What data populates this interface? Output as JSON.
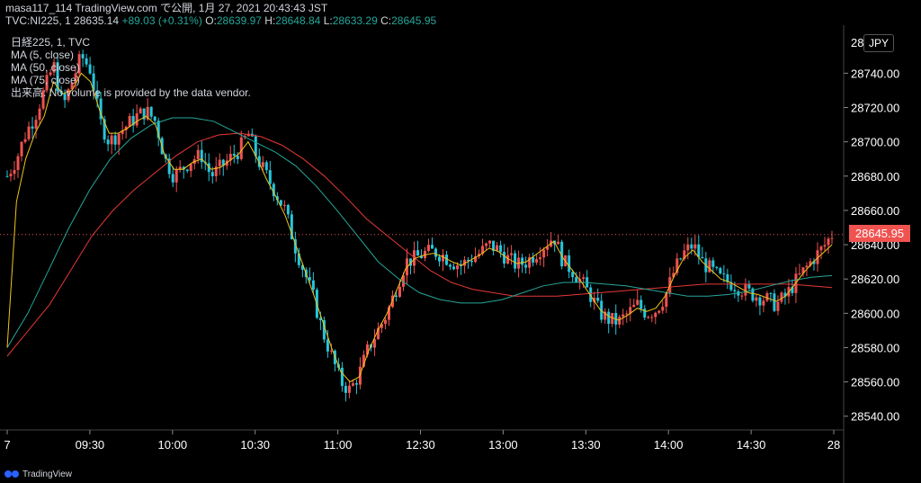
{
  "header": {
    "line1": "masa117_114 TradingView.com で公開, 1月 27, 2021 20:43:43 JST",
    "symbol": "TVC:NI225, 1",
    "price": "28635.14",
    "change": "+89.03 (+0.31%)",
    "o_label": "O:",
    "o_value": "28639.97",
    "h_label": "H:",
    "h_value": "28648.84",
    "l_label": "L:",
    "l_value": "28633.29",
    "c_label": "C:",
    "c_value": "28645.95"
  },
  "legend": {
    "title": "日経225, 1, TVC",
    "ma5": "MA (5, close)",
    "ma50": "MA (50, close)",
    "ma75": "MA (75, close)",
    "volume_note": "出来高: No volume is provided by the data vendor."
  },
  "currency": "JPY",
  "last_price_label": "28645.95",
  "branding": "TradingView",
  "colors": {
    "up": "#ef5350",
    "down": "#26c6da",
    "ma5": "#f0c419",
    "ma50": "#26a69a",
    "ma75": "#e53935",
    "axis_text": "#ffffff",
    "grid": "#1a1a1a"
  },
  "chart_data": {
    "type": "candlestick",
    "x_ticks": [
      "7",
      "09:30",
      "10:00",
      "10:30",
      "11:00",
      "12:30",
      "13:00",
      "13:30",
      "14:00",
      "14:30",
      "28"
    ],
    "y_ticks": [
      28540,
      28560,
      28580,
      28600,
      28620,
      28640,
      28660,
      28680,
      28700,
      28720,
      28740
    ],
    "ylim": [
      28532,
      28768
    ],
    "last_price": 28645.95,
    "close_path": [
      28680,
      28690,
      28705,
      28715,
      28730,
      28745,
      28720,
      28735,
      28750,
      28742,
      28712,
      28700,
      28705,
      28710,
      28715,
      28718,
      28712,
      28690,
      28680,
      28685,
      28690,
      28692,
      28680,
      28685,
      28690,
      28695,
      28705,
      28690,
      28680,
      28670,
      28660,
      28640,
      28625,
      28610,
      28590,
      28575,
      28560,
      28555,
      28565,
      28580,
      28590,
      28600,
      28615,
      28630,
      28632,
      28635,
      28636,
      28634,
      28630,
      28628,
      28632,
      28635,
      28640,
      28637,
      28632,
      28628,
      28630,
      28635,
      28640,
      28645,
      28630,
      28625,
      28618,
      28610,
      28600,
      28596,
      28595,
      28600,
      28605,
      28600,
      28602,
      28610,
      28625,
      28635,
      28640,
      28630,
      28625,
      28620,
      28618,
      28615,
      28612,
      28610,
      28608,
      28605,
      28610,
      28618,
      28625,
      28632,
      28638,
      28645.95
    ],
    "ma5_path": [
      28580,
      28665,
      28690,
      28705,
      28715,
      28735,
      28728,
      28730,
      28740,
      28735,
      28718,
      28705,
      28705,
      28708,
      28712,
      28715,
      28710,
      28692,
      28684,
      28684,
      28688,
      28690,
      28684,
      28685,
      28689,
      28693,
      28700,
      28690,
      28678,
      28668,
      28657,
      28642,
      28627,
      28612,
      28596,
      28580,
      28566,
      28560,
      28563,
      28578,
      28590,
      28600,
      28613,
      28626,
      28632,
      28634,
      28635,
      28633,
      28630,
      28628,
      28631,
      28634,
      28638,
      28636,
      28632,
      28629,
      28630,
      28634,
      28638,
      28642,
      28632,
      28625,
      28618,
      28610,
      28602,
      28598,
      28596,
      28599,
      28603,
      28601,
      28603,
      28610,
      28622,
      28632,
      28637,
      28630,
      28625,
      28620,
      28618,
      28615,
      28612,
      28611,
      28609,
      28607,
      28610,
      28617,
      28624,
      28630,
      28635,
      28640
    ],
    "ma50_path": [
      28580,
      28600,
      28625,
      28650,
      28672,
      28690,
      28702,
      28710,
      28714,
      28714,
      28712,
      28706,
      28700,
      28694,
      28686,
      28674,
      28660,
      28645,
      28630,
      28620,
      28612,
      28608,
      28606,
      28606,
      28608,
      28612,
      28616,
      28618,
      28618,
      28617,
      28616,
      28614,
      28612,
      28610,
      28610,
      28611,
      28613,
      28616,
      28619,
      28621,
      28622
    ],
    "ma75_path": [
      28575,
      28590,
      28605,
      28625,
      28645,
      28660,
      28672,
      28682,
      28692,
      28700,
      28704,
      28705,
      28703,
      28698,
      28690,
      28680,
      28668,
      28655,
      28645,
      28635,
      28625,
      28618,
      28614,
      28612,
      28610,
      28610,
      28610,
      28611,
      28612,
      28613,
      28614,
      28615,
      28616,
      28617,
      28617,
      28617,
      28617,
      28617,
      28616,
      28615
    ]
  }
}
